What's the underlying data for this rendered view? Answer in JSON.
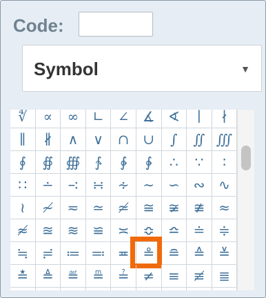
{
  "code_label": "Code:",
  "code_value": "",
  "select": {
    "selected": "Symbol",
    "arrow": "▼"
  },
  "highlight_index": 59,
  "symbols": [
    "∜",
    "∝",
    "∞",
    "∟",
    "∠",
    "∡",
    "∢",
    "∣",
    "∤",
    "∥",
    "∦",
    "∧",
    "∨",
    "∩",
    "∪",
    "∫",
    "∬",
    "∭",
    "∮",
    "∯",
    "∰",
    "∱",
    "∲",
    "∳",
    "∴",
    "∵",
    "∶",
    "∷",
    "∸",
    "∹",
    "∺",
    "∻",
    "∼",
    "∽",
    "∾",
    "∿",
    "≀",
    "≁",
    "≂",
    "≃",
    "≄",
    "≅",
    "≆",
    "≇",
    "≈",
    "≉",
    "≊",
    "≋",
    "≌",
    "≍",
    "≎",
    "≏",
    "≐",
    "≑",
    "≒",
    "≓",
    "≔",
    "≕",
    "≖",
    "≗",
    "≘",
    "≙",
    "≚",
    "≛",
    "≜",
    "≝",
    "≞",
    "≟",
    "≠",
    "≡",
    "≢",
    "≣",
    "≤",
    "≥",
    "≦",
    "≧",
    "≨",
    "≩",
    "≪",
    "≫",
    "≬"
  ]
}
